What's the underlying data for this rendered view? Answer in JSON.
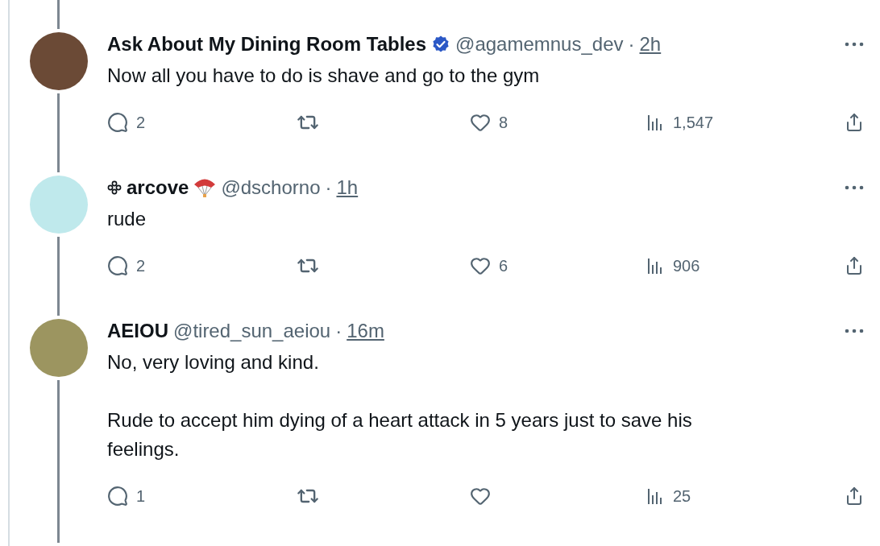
{
  "tweets": [
    {
      "avatar": {
        "color": "#6b4a36"
      },
      "display_name": "Ask About My Dining Room Tables",
      "name_icon": false,
      "emoji": false,
      "verified": true,
      "handle": "@agamemnus_dev",
      "separator": "·",
      "time": "2h",
      "body": [
        "Now all you have to do is shave and go to the gym"
      ],
      "replies": "2",
      "likes": "8",
      "views": "1,547"
    },
    {
      "avatar": {
        "color": "#bfe9ec"
      },
      "display_name": "arcove",
      "name_icon": true,
      "emoji": true,
      "verified": false,
      "handle": "@dschorno",
      "separator": "·",
      "time": "1h",
      "body": [
        "rude"
      ],
      "replies": "2",
      "likes": "6",
      "views": "906"
    },
    {
      "avatar": {
        "color": "#9c9560"
      },
      "display_name": "AEIOU",
      "name_icon": false,
      "emoji": false,
      "verified": false,
      "handle": "@tired_sun_aeiou",
      "separator": "·",
      "time": "16m",
      "body": [
        "No, very loving and kind.",
        "Rude to accept him dying of a heart attack in 5 years just to save his feelings."
      ],
      "replies": "1",
      "views": "25"
    }
  ]
}
